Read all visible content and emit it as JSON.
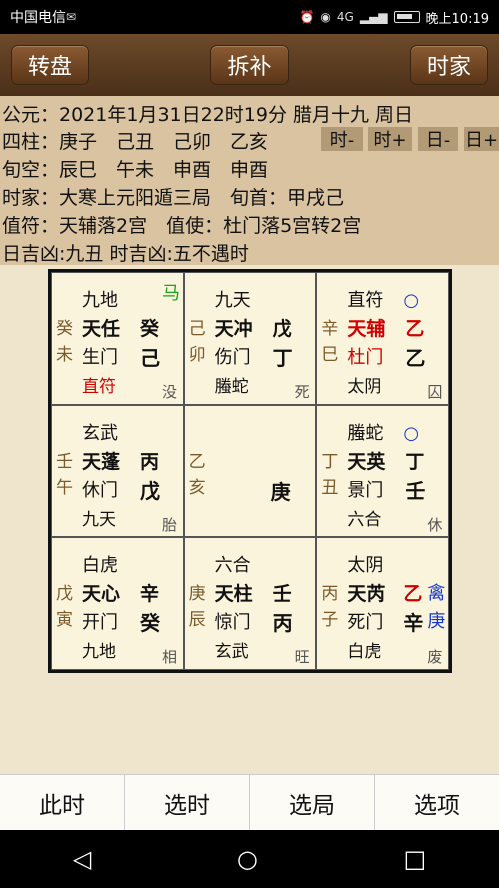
{
  "status": {
    "carrier": "中国电信",
    "time": "晚上10:19",
    "network": "4G"
  },
  "toolbar": {
    "left": "转盘",
    "middle": "拆补",
    "right": "时家"
  },
  "info": {
    "line1": "公元：2021年1月31日22时19分 腊月十九 周日",
    "line2": "四柱：庚子　己丑　己卯　乙亥",
    "line3": "旬空：辰巳　午未　申酉　申酉",
    "line4": "时家：大寒上元阳遁三局　旬首：甲戌己",
    "line5": "值符：天辅落2宫　值使：杜门落5宫转2宫",
    "line6": "日吉凶:九丑 时吉凶:五不遇时",
    "buttons": [
      "时-",
      "时+",
      "日-",
      "日+"
    ]
  },
  "cells": [
    {
      "side": [
        "癸",
        "未"
      ],
      "god": "九地",
      "star": "天任",
      "star_gan": "癸",
      "door": "生门",
      "door_gan": "己",
      "extra": "直符",
      "corner": "没",
      "badge": "马"
    },
    {
      "side": [
        "己",
        "卯"
      ],
      "god": "九天",
      "star": "天冲",
      "star_gan": "戊",
      "door": "伤门",
      "door_gan": "丁",
      "extra": "螣蛇",
      "corner": "死"
    },
    {
      "side": [
        "辛",
        "巳"
      ],
      "god": "直符",
      "star": "天辅",
      "star_gan": "乙",
      "door": "杜门",
      "door_gan": "乙",
      "extra": "太阴",
      "corner": "囚",
      "circle": "○"
    },
    {
      "side": [
        "壬",
        "午"
      ],
      "god": "玄武",
      "star": "天蓬",
      "star_gan": "丙",
      "door": "休门",
      "door_gan": "戊",
      "extra": "九天",
      "corner": "胎"
    },
    {
      "side": [
        "乙",
        "亥"
      ],
      "center_gan": "庚"
    },
    {
      "side": [
        "丁",
        "丑"
      ],
      "god": "螣蛇",
      "star": "天英",
      "star_gan": "丁",
      "door": "景门",
      "door_gan": "壬",
      "extra": "六合",
      "corner": "休",
      "circle": "○"
    },
    {
      "side": [
        "戊",
        "寅"
      ],
      "god": "白虎",
      "star": "天心",
      "star_gan": "辛",
      "door": "开门",
      "door_gan": "癸",
      "extra": "九地",
      "corner": "相"
    },
    {
      "side": [
        "庚",
        "辰"
      ],
      "god": "六合",
      "star": "天柱",
      "star_gan": "壬",
      "door": "惊门",
      "door_gan": "丙",
      "extra": "玄武",
      "corner": "旺"
    },
    {
      "side": [
        "丙",
        "子"
      ],
      "god": "太阴",
      "star": "天芮",
      "star_gan": "乙",
      "door": "死门",
      "door_gan": "辛",
      "extra": "白虎",
      "corner": "废",
      "qin": [
        "禽",
        "庚"
      ]
    }
  ],
  "bottomnav": [
    "此时",
    "选时",
    "选局",
    "选项"
  ],
  "colors": {
    "toolbar": "#5a3a1e",
    "info_bg": "#d9c3a0",
    "red": "#d10000",
    "green": "#1aa51a",
    "blue": "#1638c8"
  }
}
